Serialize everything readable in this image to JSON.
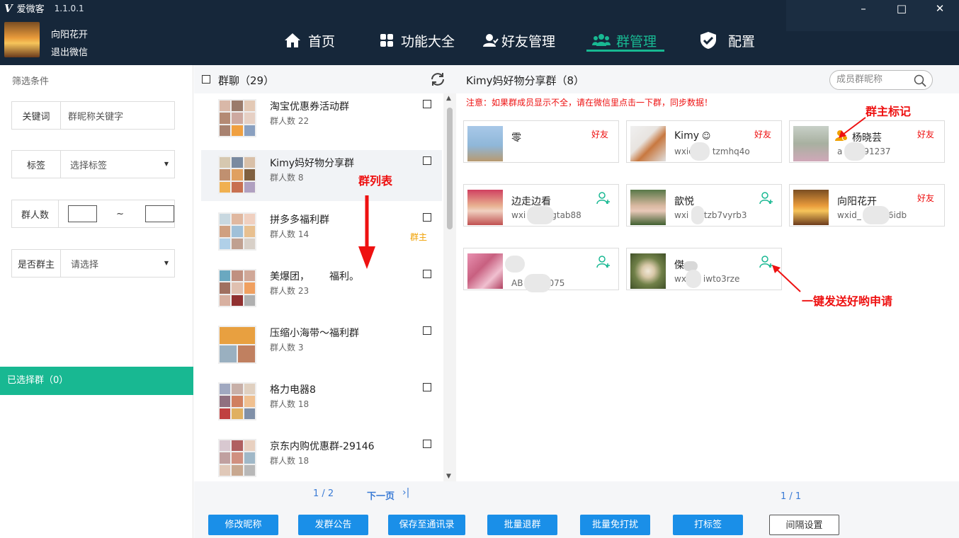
{
  "app": {
    "title": "爱微客",
    "version": "1.1.0.1",
    "logo": "V"
  },
  "window_controls": [
    "minimize-icon",
    "maximize-icon",
    "close-icon"
  ],
  "user": {
    "name": "向阳花开",
    "logout": "退出微信"
  },
  "nav": [
    {
      "label": "首页",
      "icon": "home-icon"
    },
    {
      "label": "功能大全",
      "icon": "grid-icon"
    },
    {
      "label": "好友管理",
      "icon": "friend-icon"
    },
    {
      "label": "群管理",
      "icon": "group-icon",
      "active": true
    },
    {
      "label": "配置",
      "icon": "shield-check-icon"
    }
  ],
  "filter": {
    "title": "筛选条件",
    "keyword": {
      "label": "关键词",
      "placeholder": "群昵称关键字"
    },
    "tag": {
      "label": "标签",
      "value": "选择标签"
    },
    "member_count": {
      "label": "群人数",
      "sep": "~"
    },
    "is_owner": {
      "label": "是否群主",
      "value": "请选择"
    },
    "selected": "已选择群（0）"
  },
  "groups": {
    "title": "群聊（29）",
    "items": [
      {
        "name": "淘宝优惠券活动群",
        "count": "群人数 22"
      },
      {
        "name": "Kimy妈好物分享群",
        "count": "群人数 8",
        "selected": true
      },
      {
        "name": "拼多多福利群",
        "count": "群人数 14",
        "owner": "群主"
      },
      {
        "name": "美爆团，",
        "name2": "福利。",
        "count": "群人数 23"
      },
      {
        "name": "压缩小海带～福利群",
        "count": "群人数 3"
      },
      {
        "name": "格力电器8",
        "count": "群人数 18"
      },
      {
        "name": "京东内购优惠群-29146",
        "count": "群人数 18"
      }
    ],
    "page": "1 / 2",
    "next": "下一页",
    "annotation": "群列表"
  },
  "members": {
    "title": "Kimy妈好物分享群（8）",
    "search_placeholder": "成员群昵称",
    "notice": "注意：如果群成员显示不全，请在微信里点击一下群，同步数据！",
    "friend_label": "好友",
    "items": [
      {
        "name": "零",
        "wx": "",
        "status": "friend"
      },
      {
        "name": "Kimy",
        "wx_prefix": "wxid",
        "wx_suffix": "tzmhq4o",
        "status": "friend"
      },
      {
        "name": "杨晓芸",
        "wx_prefix": "a",
        "wx_suffix": "91237",
        "status": "friend",
        "owner": true
      },
      {
        "name": "边走边看",
        "wx_prefix": "wxi",
        "wx_suffix": "gtab88",
        "status": "add"
      },
      {
        "name": "歆悦",
        "wx_prefix": "wxi",
        "wx_suffix": "0tzb7vyrb3",
        "status": "add"
      },
      {
        "name": "向阳花开",
        "wx_prefix": "wxid_",
        "wx_suffix": "6idb",
        "status": "friend"
      },
      {
        "name": "",
        "wx_prefix": "AB",
        "wx_suffix": "075",
        "status": "add"
      },
      {
        "name": "傑",
        "wx_prefix": "wx",
        "wx_suffix": "iwto3rze",
        "status": "add"
      }
    ],
    "page": "1 / 1",
    "annotation_owner": "群主标记",
    "annotation_send": "一键发送好哟申请"
  },
  "buttons": [
    "修改昵称",
    "发群公告",
    "保存至通讯录",
    "批量退群",
    "批量免打扰",
    "打标签",
    "间隔设置"
  ],
  "colors": {
    "topbar": "#16273a",
    "accent": "#18b892",
    "button": "#1a8fe8",
    "annotation": "#ee1111",
    "owner": "#f0a000"
  }
}
